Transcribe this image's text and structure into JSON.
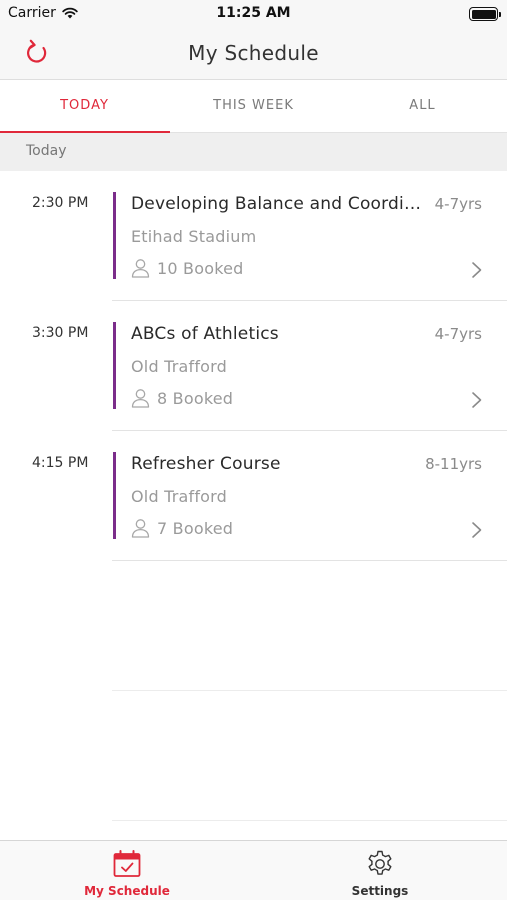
{
  "status_bar": {
    "carrier": "Carrier",
    "time": "11:25 AM"
  },
  "nav": {
    "title": "My Schedule",
    "refresh_icon": "refresh-icon"
  },
  "tabs": [
    {
      "label": "TODAY",
      "active": true
    },
    {
      "label": "THIS WEEK",
      "active": false
    },
    {
      "label": "ALL",
      "active": false
    }
  ],
  "section": {
    "label": "Today"
  },
  "sessions": [
    {
      "time": "2:30 PM",
      "title": "Developing Balance and Coordination",
      "age": "4-7yrs",
      "venue": "Etihad Stadium",
      "booked": "10 Booked"
    },
    {
      "time": "3:30 PM",
      "title": "ABCs of Athletics",
      "age": "4-7yrs",
      "venue": "Old Trafford",
      "booked": "8 Booked"
    },
    {
      "time": "4:15 PM",
      "title": "Refresher Course",
      "age": "8-11yrs",
      "venue": "Old Trafford",
      "booked": "7 Booked"
    }
  ],
  "bottom_tabs": [
    {
      "label": "My Schedule",
      "icon": "calendar-check-icon",
      "active": true
    },
    {
      "label": "Settings",
      "icon": "gear-icon",
      "active": false
    }
  ],
  "colors": {
    "accent": "#e0283a",
    "session_bar": "#7b2d8a",
    "inactive": "#333333"
  }
}
